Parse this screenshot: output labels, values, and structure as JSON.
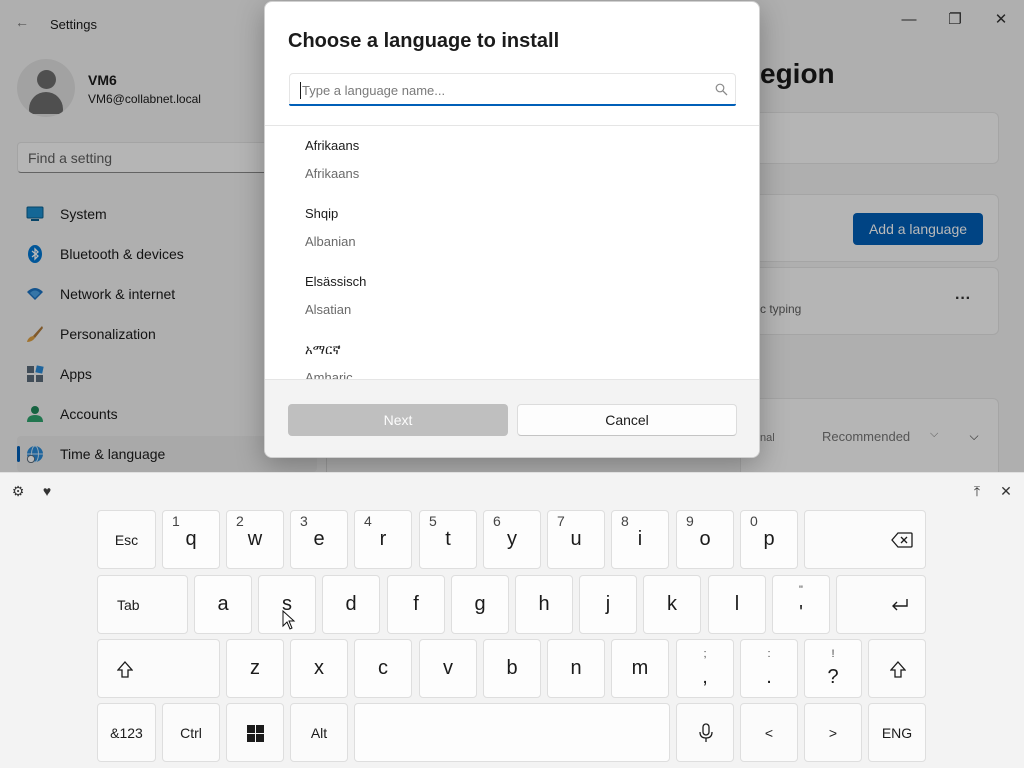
{
  "window": {
    "title": "Settings",
    "back_glyph": "←",
    "minimize_glyph": "—",
    "maximize_glyph": "❐",
    "close_glyph": "✕"
  },
  "profile": {
    "name": "VM6",
    "email": "VM6@collabnet.local"
  },
  "search": {
    "placeholder": "Find a setting"
  },
  "sidebar": {
    "items": [
      {
        "label": "System",
        "icon": "system-icon",
        "active": false
      },
      {
        "label": "Bluetooth & devices",
        "icon": "bluetooth-icon",
        "active": false
      },
      {
        "label": "Network & internet",
        "icon": "network-icon",
        "active": false
      },
      {
        "label": "Personalization",
        "icon": "brush-icon",
        "active": false
      },
      {
        "label": "Apps",
        "icon": "apps-icon",
        "active": false
      },
      {
        "label": "Accounts",
        "icon": "accounts-icon",
        "active": false
      },
      {
        "label": "Time & language",
        "icon": "globe-clock-icon",
        "active": true
      }
    ]
  },
  "main": {
    "title_partial": "egion",
    "add_language_label": "Add a language",
    "typing_partial": "c typing",
    "more_glyph": "···",
    "regional_partial": "nal",
    "recommended_label": "Recommended",
    "chevron_glyph": "⌵"
  },
  "dialog": {
    "title": "Choose a language to install",
    "search_placeholder": "Type a language name...",
    "languages": [
      {
        "native": "Afrikaans",
        "english": "Afrikaans"
      },
      {
        "native": "Shqip",
        "english": "Albanian"
      },
      {
        "native": "Elsässisch",
        "english": "Alsatian"
      },
      {
        "native": "አማርኛ",
        "english": "Amharic"
      }
    ],
    "next_label": "Next",
    "cancel_label": "Cancel"
  },
  "keyboard": {
    "toolbar": {
      "settings_glyph": "⚙",
      "emoji_glyph": "♥",
      "dock_glyph": "⤒",
      "close_glyph": "✕"
    },
    "row1": [
      {
        "main": "Esc"
      },
      {
        "main": "q",
        "alt": "1"
      },
      {
        "main": "w",
        "alt": "2"
      },
      {
        "main": "e",
        "alt": "3"
      },
      {
        "main": "r",
        "alt": "4"
      },
      {
        "main": "t",
        "alt": "5"
      },
      {
        "main": "y",
        "alt": "6"
      },
      {
        "main": "u",
        "alt": "7"
      },
      {
        "main": "i",
        "alt": "8"
      },
      {
        "main": "o",
        "alt": "9"
      },
      {
        "main": "p",
        "alt": "0"
      }
    ],
    "row2": [
      {
        "main": "Tab"
      },
      {
        "main": "a"
      },
      {
        "main": "s"
      },
      {
        "main": "d"
      },
      {
        "main": "f"
      },
      {
        "main": "g"
      },
      {
        "main": "h"
      },
      {
        "main": "j"
      },
      {
        "main": "k"
      },
      {
        "main": "l"
      },
      {
        "main": "'",
        "top": "\""
      }
    ],
    "row3": [
      {
        "main": "z"
      },
      {
        "main": "x"
      },
      {
        "main": "c"
      },
      {
        "main": "v"
      },
      {
        "main": "b"
      },
      {
        "main": "n"
      },
      {
        "main": "m"
      },
      {
        "main": ",",
        "top": ";"
      },
      {
        "main": ".",
        "top": ":"
      },
      {
        "main": "?",
        "top": "!"
      }
    ],
    "row4": {
      "symbols": "&123",
      "ctrl": "Ctrl",
      "alt": "Alt",
      "left": "<",
      "right": ">",
      "lang": "ENG"
    }
  }
}
